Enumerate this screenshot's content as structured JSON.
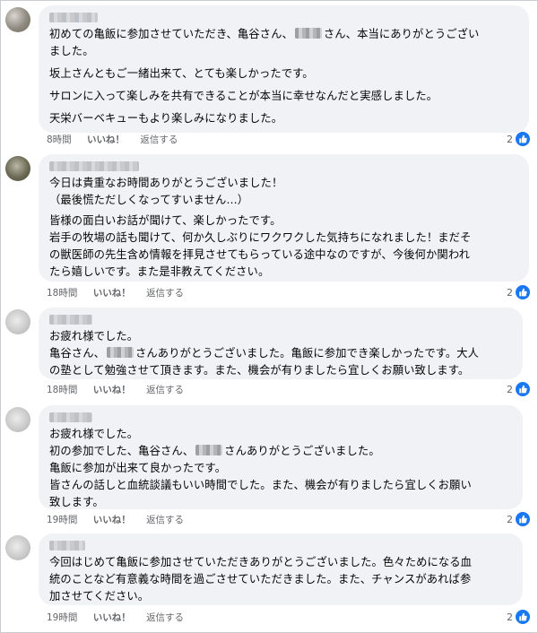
{
  "comments": [
    {
      "lines": [
        [
          "初めての亀飯に参加させていただき、亀谷さん、",
          "さん、本当にありがとうござい"
        ],
        [
          "ました。"
        ],
        [
          "坂上さんともご一緒出来て、とても楽しかったです。"
        ],
        [
          "サロンに入って楽しみを共有できることが本当に幸せなんだと実感しました。"
        ],
        [
          "天栄バーベキューもより楽しみになりました。"
        ]
      ],
      "time": "8時間",
      "like": "いいね！",
      "reply": "返信する",
      "reactions": "2"
    },
    {
      "lines": [
        [
          "今日は貴重なお時間ありがとうございました！"
        ],
        [
          "（最後慌ただしくなってすいません…）"
        ],
        [
          "皆様の面白いお話が聞けて、楽しかったです。"
        ],
        [
          "岩手の牧場の話も聞けて、何か久しぶりにワクワクした気持ちになれました！まだそ"
        ],
        [
          "の獣医師の先生含め情報を拝見させてもらっている途中なのですが、今後何か関われ"
        ],
        [
          "たら嬉しいです。また是非教えてください。"
        ]
      ],
      "time": "18時間",
      "like": "いいね！",
      "reply": "返信する",
      "reactions": "2"
    },
    {
      "lines": [
        [
          "お疲れ様でした。"
        ],
        [
          "亀谷さん、",
          "さんありがとうございました。亀飯に参加でき楽しかったです。大人"
        ],
        [
          "の塾として勉強させて頂きます。また、機会が有りましたら宜しくお願い致します。"
        ]
      ],
      "time": "18時間",
      "like": "いいね！",
      "reply": "返信する",
      "reactions": "2"
    },
    {
      "lines": [
        [
          "お疲れ様でした。"
        ],
        [
          "初の参加でした、亀谷さん、",
          "さんありがとうございました。"
        ],
        [
          "亀飯に参加が出来て良かったです。"
        ],
        [
          "皆さんの話しと血統談議もいい時間でした。また、機会が有りましたら宜しくお願い"
        ],
        [
          "致します。"
        ]
      ],
      "time": "19時間",
      "like": "いいね！",
      "reply": "返信する",
      "reactions": "2"
    },
    {
      "lines": [
        [
          "今回はじめて亀飯に参加させていただきありがとうございました。色々ためになる血"
        ],
        [
          "統のことなど有意義な時間を過ごさせていただきました。また、チャンスがあれば参"
        ],
        [
          "加させてください。"
        ]
      ],
      "time": "19時間",
      "like": "いいね！",
      "reply": "返信する",
      "reactions": "2"
    }
  ]
}
